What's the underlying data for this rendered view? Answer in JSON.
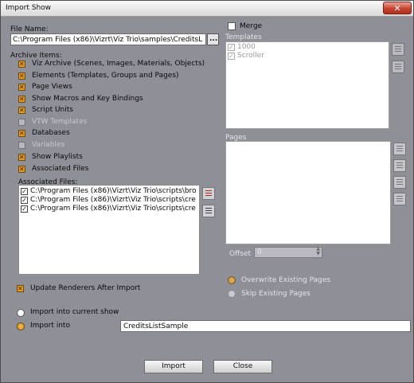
{
  "window": {
    "title": "Import Show",
    "close_glyph": "✕"
  },
  "file_name": {
    "label": "File Name:",
    "value": "C:\\Program Files (x86)\\Vizrt\\Viz Trio\\samples\\CreditsL",
    "browse_glyph": "..."
  },
  "archive": {
    "label": "Archive Items:",
    "items": [
      {
        "label": "Viz Archive (Scenes, Images, Materials, Objects)",
        "checked": true
      },
      {
        "label": "Elements (Templates, Groups and Pages)",
        "checked": true
      },
      {
        "label": "Page Views",
        "checked": true
      },
      {
        "label": "Show Macros and Key Bindings",
        "checked": true
      },
      {
        "label": "Script Units",
        "checked": true
      },
      {
        "label": "VTW Templates",
        "checked": false
      },
      {
        "label": "Databases",
        "checked": true
      },
      {
        "label": "Variables",
        "checked": false
      },
      {
        "label": "Show Playlists",
        "checked": true
      },
      {
        "label": "Associated Files",
        "checked": true
      }
    ]
  },
  "associated_files": {
    "label": "Associated Files:",
    "items": [
      "C:\\Program Files (x86)\\Vizrt\\Viz Trio\\scripts\\bro",
      "C:\\Program Files (x86)\\Vizrt\\Viz Trio\\scripts\\cre",
      "C:\\Program Files (x86)\\Vizrt\\Viz Trio\\scripts\\cre"
    ]
  },
  "update_renderers": {
    "label": "Update Renderers After Import"
  },
  "import_into_current": {
    "label": "Import into current show"
  },
  "import_into": {
    "label": "Import into",
    "value": "CreditsListSample"
  },
  "merge": {
    "label": "Merge"
  },
  "templates": {
    "label": "Templates",
    "items": [
      "1000",
      "Scroller"
    ]
  },
  "pages": {
    "label": "Pages"
  },
  "offset": {
    "label": "Offset",
    "value": "0"
  },
  "overwrite": {
    "label": "Overwrite Existing Pages"
  },
  "skip": {
    "label": "Skip Existing Pages"
  },
  "buttons": {
    "import": "Import",
    "close": "Close"
  },
  "colors": {
    "background": "#8f8f97",
    "accent": "#e89c1e"
  }
}
